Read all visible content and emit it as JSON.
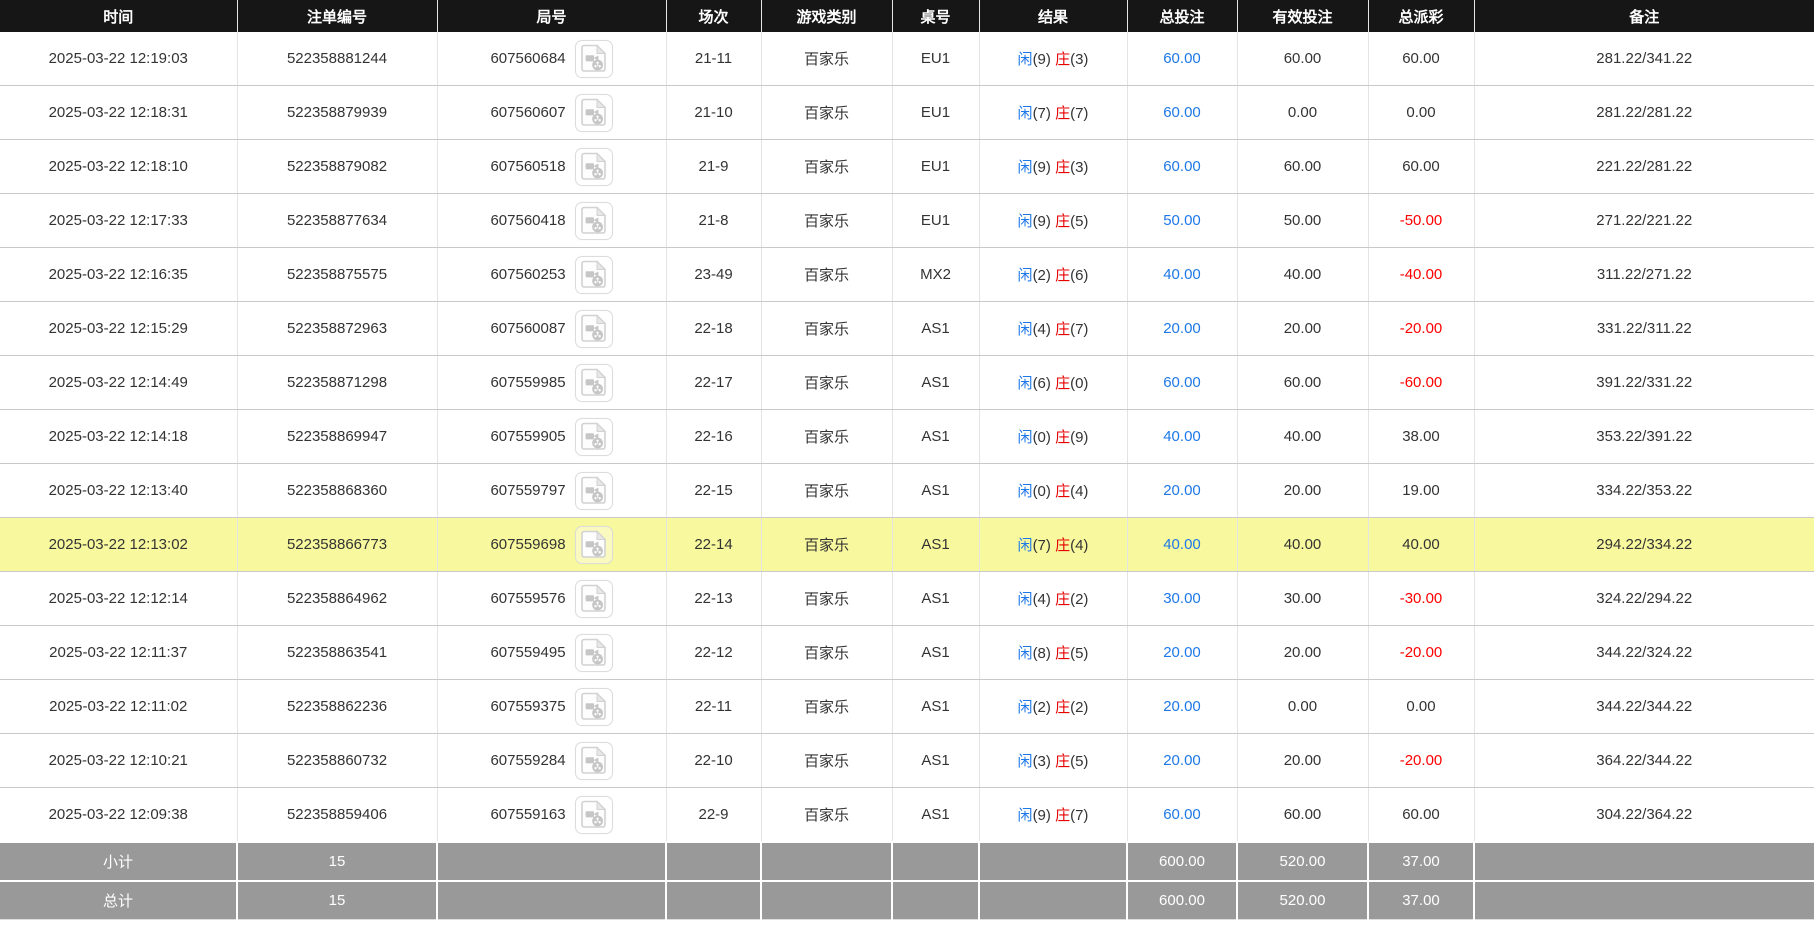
{
  "columns": [
    "时间",
    "注单编号",
    "局号",
    "场次",
    "游戏类别",
    "桌号",
    "结果",
    "总投注",
    "有效投注",
    "总派彩",
    "备注"
  ],
  "icons": {
    "round_column_icon": "video-file-icon"
  },
  "colors": {
    "header_bg": "#161616",
    "header_text": "#ffffff",
    "body_text": "#333333",
    "link_blue": "#1e78e8",
    "player_blue": "#1e78e8",
    "banker_red": "#e60000",
    "negative_red": "#ff0000",
    "highlight_row_bg": "#f8f89e",
    "summary_bg": "#999999",
    "row_border": "#c9c9c9"
  },
  "rows": [
    {
      "time": "2025-03-22 12:19:03",
      "bet_id": "522358881244",
      "round_id": "607560684",
      "session": "21-11",
      "game": "百家乐",
      "table": "EU1",
      "result": {
        "player": "闲(9)",
        "banker": "庄(3)"
      },
      "total_bet": "60.00",
      "valid_bet": "60.00",
      "payout": "60.00",
      "remark": "281.22/341.22",
      "highlight": false
    },
    {
      "time": "2025-03-22 12:18:31",
      "bet_id": "522358879939",
      "round_id": "607560607",
      "session": "21-10",
      "game": "百家乐",
      "table": "EU1",
      "result": {
        "player": "闲(7)",
        "banker": "庄(7)"
      },
      "total_bet": "60.00",
      "valid_bet": "0.00",
      "payout": "0.00",
      "remark": "281.22/281.22",
      "highlight": false
    },
    {
      "time": "2025-03-22 12:18:10",
      "bet_id": "522358879082",
      "round_id": "607560518",
      "session": "21-9",
      "game": "百家乐",
      "table": "EU1",
      "result": {
        "player": "闲(9)",
        "banker": "庄(3)"
      },
      "total_bet": "60.00",
      "valid_bet": "60.00",
      "payout": "60.00",
      "remark": "221.22/281.22",
      "highlight": false
    },
    {
      "time": "2025-03-22 12:17:33",
      "bet_id": "522358877634",
      "round_id": "607560418",
      "session": "21-8",
      "game": "百家乐",
      "table": "EU1",
      "result": {
        "player": "闲(9)",
        "banker": "庄(5)"
      },
      "total_bet": "50.00",
      "valid_bet": "50.00",
      "payout": "-50.00",
      "remark": "271.22/221.22",
      "highlight": false
    },
    {
      "time": "2025-03-22 12:16:35",
      "bet_id": "522358875575",
      "round_id": "607560253",
      "session": "23-49",
      "game": "百家乐",
      "table": "MX2",
      "result": {
        "player": "闲(2)",
        "banker": "庄(6)"
      },
      "total_bet": "40.00",
      "valid_bet": "40.00",
      "payout": "-40.00",
      "remark": "311.22/271.22",
      "highlight": false
    },
    {
      "time": "2025-03-22 12:15:29",
      "bet_id": "522358872963",
      "round_id": "607560087",
      "session": "22-18",
      "game": "百家乐",
      "table": "AS1",
      "result": {
        "player": "闲(4)",
        "banker": "庄(7)"
      },
      "total_bet": "20.00",
      "valid_bet": "20.00",
      "payout": "-20.00",
      "remark": "331.22/311.22",
      "highlight": false
    },
    {
      "time": "2025-03-22 12:14:49",
      "bet_id": "522358871298",
      "round_id": "607559985",
      "session": "22-17",
      "game": "百家乐",
      "table": "AS1",
      "result": {
        "player": "闲(6)",
        "banker": "庄(0)"
      },
      "total_bet": "60.00",
      "valid_bet": "60.00",
      "payout": "-60.00",
      "remark": "391.22/331.22",
      "highlight": false
    },
    {
      "time": "2025-03-22 12:14:18",
      "bet_id": "522358869947",
      "round_id": "607559905",
      "session": "22-16",
      "game": "百家乐",
      "table": "AS1",
      "result": {
        "player": "闲(0)",
        "banker": "庄(9)"
      },
      "total_bet": "40.00",
      "valid_bet": "40.00",
      "payout": "38.00",
      "remark": "353.22/391.22",
      "highlight": false
    },
    {
      "time": "2025-03-22 12:13:40",
      "bet_id": "522358868360",
      "round_id": "607559797",
      "session": "22-15",
      "game": "百家乐",
      "table": "AS1",
      "result": {
        "player": "闲(0)",
        "banker": "庄(4)"
      },
      "total_bet": "20.00",
      "valid_bet": "20.00",
      "payout": "19.00",
      "remark": "334.22/353.22",
      "highlight": false
    },
    {
      "time": "2025-03-22 12:13:02",
      "bet_id": "522358866773",
      "round_id": "607559698",
      "session": "22-14",
      "game": "百家乐",
      "table": "AS1",
      "result": {
        "player": "闲(7)",
        "banker": "庄(4)"
      },
      "total_bet": "40.00",
      "valid_bet": "40.00",
      "payout": "40.00",
      "remark": "294.22/334.22",
      "highlight": true
    },
    {
      "time": "2025-03-22 12:12:14",
      "bet_id": "522358864962",
      "round_id": "607559576",
      "session": "22-13",
      "game": "百家乐",
      "table": "AS1",
      "result": {
        "player": "闲(4)",
        "banker": "庄(2)"
      },
      "total_bet": "30.00",
      "valid_bet": "30.00",
      "payout": "-30.00",
      "remark": "324.22/294.22",
      "highlight": false
    },
    {
      "time": "2025-03-22 12:11:37",
      "bet_id": "522358863541",
      "round_id": "607559495",
      "session": "22-12",
      "game": "百家乐",
      "table": "AS1",
      "result": {
        "player": "闲(8)",
        "banker": "庄(5)"
      },
      "total_bet": "20.00",
      "valid_bet": "20.00",
      "payout": "-20.00",
      "remark": "344.22/324.22",
      "highlight": false
    },
    {
      "time": "2025-03-22 12:11:02",
      "bet_id": "522358862236",
      "round_id": "607559375",
      "session": "22-11",
      "game": "百家乐",
      "table": "AS1",
      "result": {
        "player": "闲(2)",
        "banker": "庄(2)"
      },
      "total_bet": "20.00",
      "valid_bet": "0.00",
      "payout": "0.00",
      "remark": "344.22/344.22",
      "highlight": false
    },
    {
      "time": "2025-03-22 12:10:21",
      "bet_id": "522358860732",
      "round_id": "607559284",
      "session": "22-10",
      "game": "百家乐",
      "table": "AS1",
      "result": {
        "player": "闲(3)",
        "banker": "庄(5)"
      },
      "total_bet": "20.00",
      "valid_bet": "20.00",
      "payout": "-20.00",
      "remark": "364.22/344.22",
      "highlight": false
    },
    {
      "time": "2025-03-22 12:09:38",
      "bet_id": "522358859406",
      "round_id": "607559163",
      "session": "22-9",
      "game": "百家乐",
      "table": "AS1",
      "result": {
        "player": "闲(9)",
        "banker": "庄(7)"
      },
      "total_bet": "60.00",
      "valid_bet": "60.00",
      "payout": "60.00",
      "remark": "304.22/364.22",
      "highlight": false
    }
  ],
  "summary": [
    {
      "label": "小计",
      "count": "15",
      "total_bet": "600.00",
      "valid_bet": "520.00",
      "payout": "37.00"
    },
    {
      "label": "总计",
      "count": "15",
      "total_bet": "600.00",
      "valid_bet": "520.00",
      "payout": "37.00"
    }
  ]
}
